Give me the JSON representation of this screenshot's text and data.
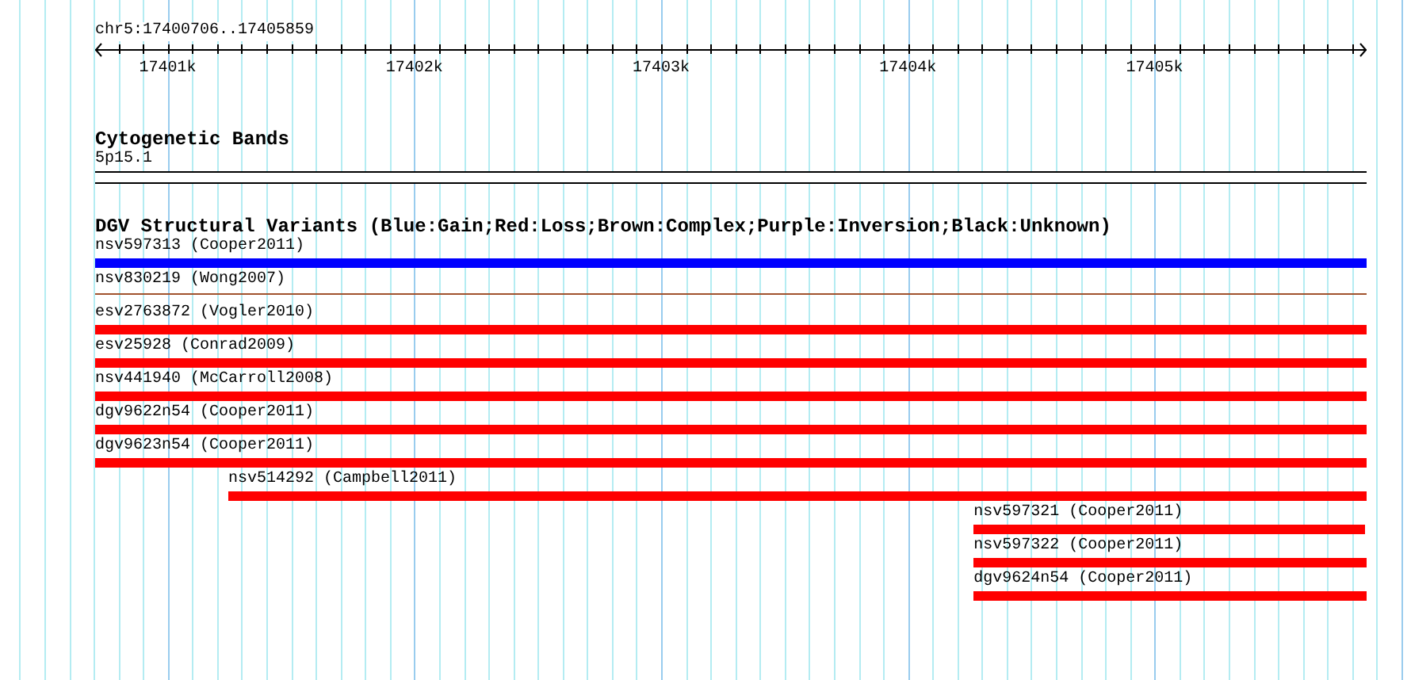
{
  "ruler": {
    "location": "chr5:17400706..17405859",
    "ticks": [
      {
        "label": "17401k"
      },
      {
        "label": "17402k"
      },
      {
        "label": "17403k"
      },
      {
        "label": "17404k"
      },
      {
        "label": "17405k"
      }
    ]
  },
  "cytoband": {
    "title": "Cytogenetic Bands",
    "label": "5p15.1"
  },
  "variants": {
    "title": "DGV Structural Variants (Blue:Gain;Red:Loss;Brown:Complex;Purple:Inversion;Black:Unknown)",
    "features": [
      {
        "label": "nsv597313 (Cooper2011)",
        "kind": "bar",
        "color": "#0000ff"
      },
      {
        "label": "nsv830219 (Wong2007)",
        "kind": "line",
        "color": "#a0522d"
      },
      {
        "label": "esv2763872 (Vogler2010)",
        "kind": "bar",
        "color": "#ff0000"
      },
      {
        "label": "esv25928 (Conrad2009)",
        "kind": "bar",
        "color": "#ff0000"
      },
      {
        "label": "nsv441940 (McCarroll2008)",
        "kind": "bar",
        "color": "#ff0000"
      },
      {
        "label": "dgv9622n54 (Cooper2011)",
        "kind": "bar",
        "color": "#ff0000"
      },
      {
        "label": "dgv9623n54 (Cooper2011)",
        "kind": "bar",
        "color": "#ff0000"
      },
      {
        "label": "nsv514292 (Campbell2011)",
        "kind": "bar",
        "color": "#ff0000"
      },
      {
        "label": "nsv597321 (Cooper2011)",
        "kind": "bar",
        "color": "#ff0000"
      },
      {
        "label": "nsv597322 (Cooper2011)",
        "kind": "bar",
        "color": "#ff0000"
      },
      {
        "label": "dgv9624n54 (Cooper2011)",
        "kind": "bar",
        "color": "#ff0000"
      }
    ]
  }
}
